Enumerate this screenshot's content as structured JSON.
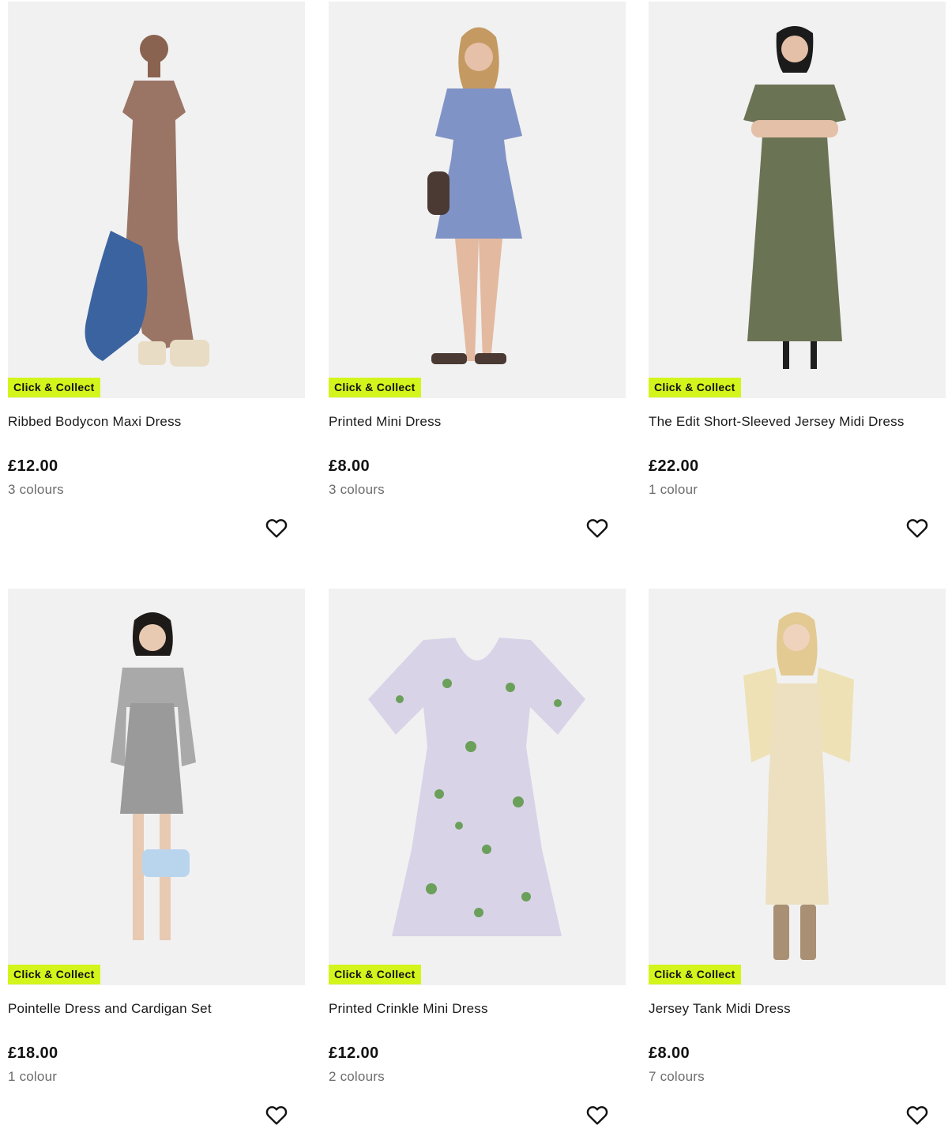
{
  "products": [
    {
      "title": "Ribbed Bodycon Maxi Dress",
      "price": "£12.00",
      "colours": "3 colours",
      "badge": "Click & Collect",
      "dress_color": "#9a7566",
      "accent_color": "#3b63a0"
    },
    {
      "title": "Printed Mini Dress",
      "price": "£8.00",
      "colours": "3 colours",
      "badge": "Click & Collect",
      "dress_color": "#8093c6",
      "accent_color": "#4a3a33"
    },
    {
      "title": "The Edit Short-Sleeved Jersey Midi Dress",
      "price": "£22.00",
      "colours": "1 colour",
      "badge": "Click & Collect",
      "dress_color": "#6b7355",
      "accent_color": "#1e1e1e"
    },
    {
      "title": "Pointelle Dress and Cardigan Set",
      "price": "£18.00",
      "colours": "1 colour",
      "badge": "Click & Collect",
      "dress_color": "#9a9a9a",
      "accent_color": "#b9d5ee"
    },
    {
      "title": "Printed Crinkle Mini Dress",
      "price": "£12.00",
      "colours": "2 colours",
      "badge": "Click & Collect",
      "dress_color": "#d9d3e8",
      "accent_color": "#6aa05a"
    },
    {
      "title": "Jersey Tank Midi Dress",
      "price": "£8.00",
      "colours": "7 colours",
      "badge": "Click & Collect",
      "dress_color": "#ece0c0",
      "accent_color": "#a98f73"
    }
  ],
  "icons": {
    "favourite": "heart-outline-icon"
  },
  "colors": {
    "badge_bg": "#d4f51b",
    "image_bg": "#f1f1f1",
    "muted_text": "#6b6b6b"
  }
}
